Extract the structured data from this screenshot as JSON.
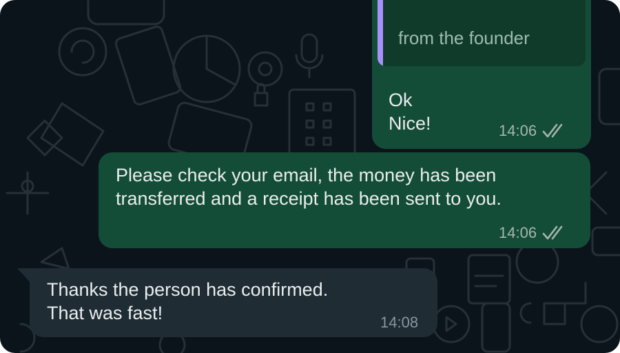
{
  "colors": {
    "background": "#0b141a",
    "outgoing_bubble": "#144d37",
    "incoming_bubble": "#1f2c33",
    "quote_bar": "#a791f8",
    "text": "#e9edef"
  },
  "messages": [
    {
      "direction": "outgoing",
      "quote_text": "from the founder",
      "text": "Ok\nNice!",
      "time": "14:06",
      "status_icon": "double-check-icon"
    },
    {
      "direction": "outgoing",
      "text": "Please check your email, the money has been\ntransferred and a receipt has been sent to you.",
      "time": "14:06",
      "status_icon": "double-check-icon"
    },
    {
      "direction": "incoming",
      "text": "Thanks the person has confirmed.\nThat was fast!",
      "time": "14:08"
    }
  ]
}
